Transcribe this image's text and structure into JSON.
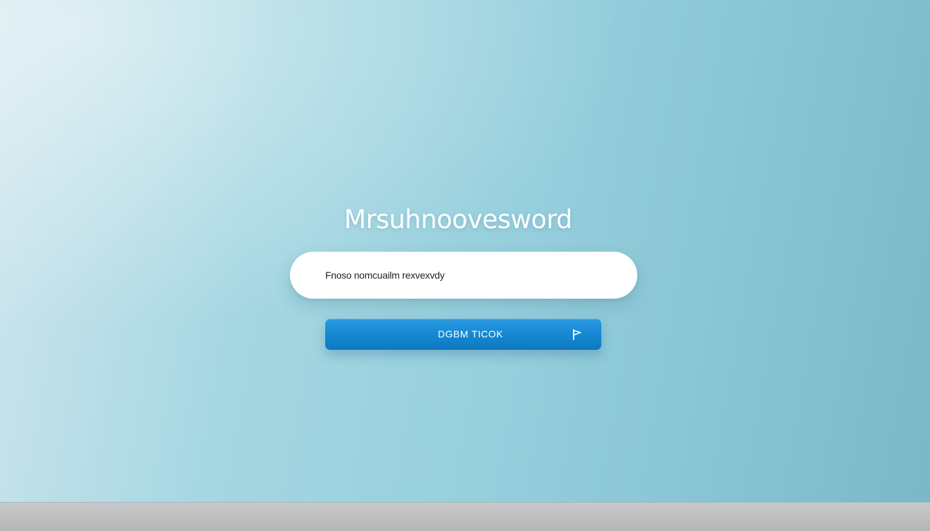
{
  "login": {
    "title": "Mrsuhnoovesword",
    "field_text": "Fnoso nomcuailm rexvexvdy",
    "button_label": "DGBM TICOK",
    "button_icon": "flag-icon"
  },
  "colors": {
    "accent": "#1487d2",
    "background": "#96cfdd",
    "field": "#ffffff"
  }
}
